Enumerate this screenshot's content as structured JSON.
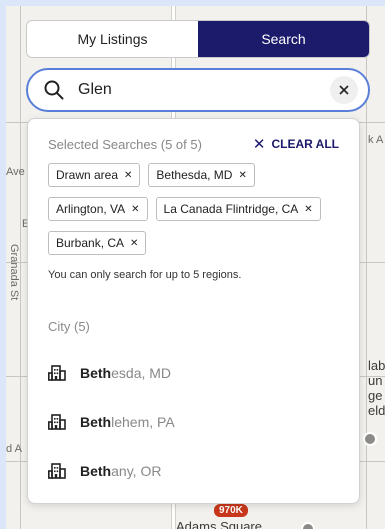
{
  "tabs": [
    {
      "label": "My Listings",
      "active": false
    },
    {
      "label": "Search",
      "active": true
    }
  ],
  "search": {
    "value": "Glen",
    "placeholder": ""
  },
  "selected": {
    "title": "Selected Searches (5 of 5)",
    "clear_all_label": "CLEAR ALL",
    "chips": [
      {
        "label": "Drawn area"
      },
      {
        "label": "Bethesda, MD"
      },
      {
        "label": "Arlington, VA"
      },
      {
        "label": "La Canada Flintridge, CA"
      },
      {
        "label": "Burbank, CA"
      }
    ],
    "limit_note": "You can only search for up to 5 regions."
  },
  "cities": {
    "heading": "City (5)",
    "items": [
      {
        "match": "Beth",
        "rest": "esda, MD"
      },
      {
        "match": "Beth",
        "rest": "lehem, PA"
      },
      {
        "match": "Beth",
        "rest": "any, OR"
      }
    ]
  },
  "map": {
    "labels": {
      "ave": "Ave",
      "e": "E",
      "granada": "Granada St",
      "d_a": "d A",
      "k_a": "k A",
      "right_text": "lab\nun\nge\neld",
      "bottom_street": "Adams Square"
    },
    "price_pin": "970K"
  },
  "colors": {
    "accent": "#1c1a6b",
    "search_border": "#5a7fd8",
    "pin": "#c8371b"
  }
}
